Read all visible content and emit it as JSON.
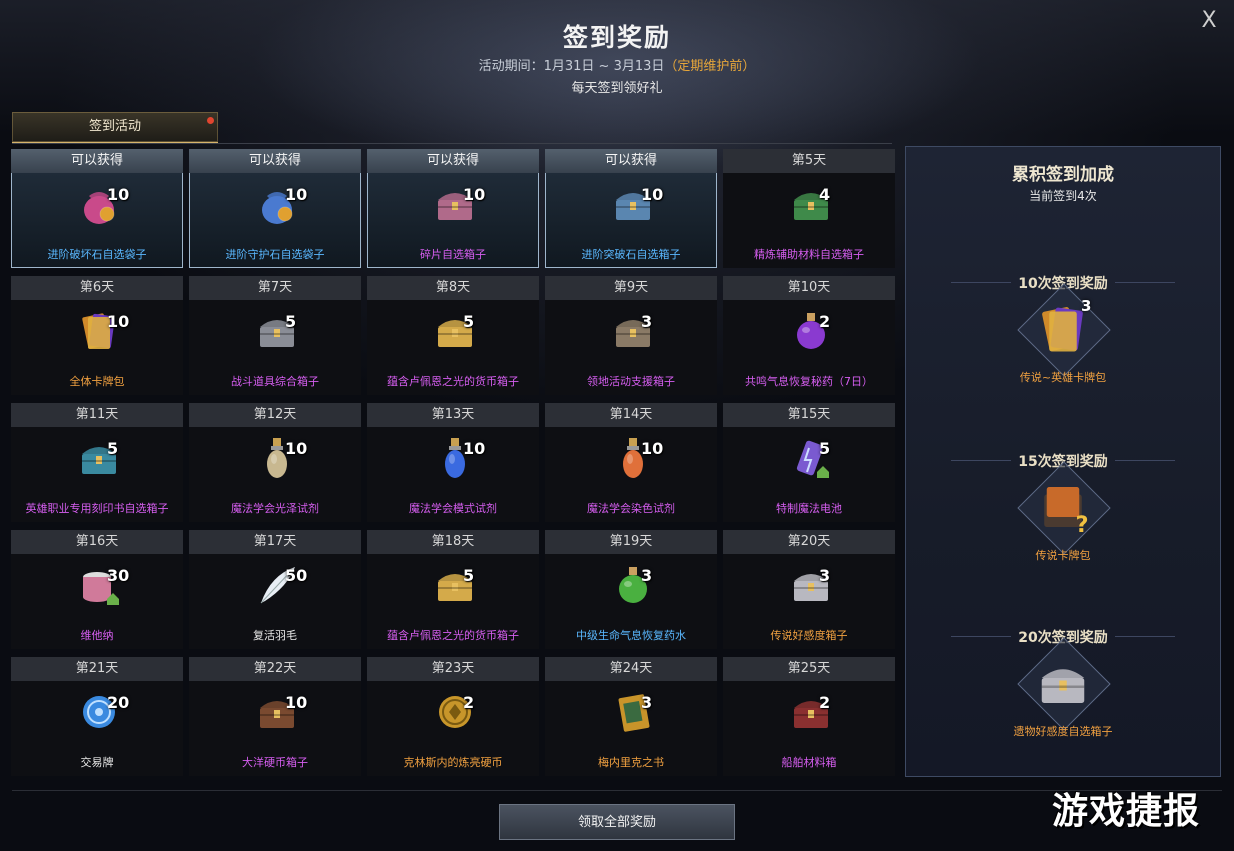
{
  "header": {
    "title": "签到奖励",
    "period_prefix": "活动期间：",
    "period_range": "1月31日 ~ 3月13日",
    "period_note": "（定期维护前）",
    "daily_text": "每天签到领好礼",
    "close_label": "X"
  },
  "tabs": [
    {
      "label": "签到活动"
    }
  ],
  "cells": [
    {
      "header": "可以获得",
      "qty": "10",
      "name": "进阶破坏石自选袋子",
      "icon": "pouch-icon",
      "state": "available",
      "rarity": "blue",
      "color": "#c94a8a"
    },
    {
      "header": "可以获得",
      "qty": "10",
      "name": "进阶守护石自选袋子",
      "icon": "pouch-icon",
      "state": "available",
      "rarity": "blue",
      "color": "#4a7ad0"
    },
    {
      "header": "可以获得",
      "qty": "10",
      "name": "碎片自选箱子",
      "icon": "chest-icon",
      "state": "available",
      "rarity": "purple",
      "color": "#b06a8a"
    },
    {
      "header": "可以获得",
      "qty": "10",
      "name": "进阶突破石自选箱子",
      "icon": "chest-icon",
      "state": "available",
      "rarity": "blue",
      "color": "#5a86b0"
    },
    {
      "header": "第5天",
      "qty": "4",
      "name": "精炼辅助材料自选箱子",
      "icon": "chest-icon",
      "state": "locked",
      "rarity": "purple",
      "color": "#3f8a4a"
    },
    {
      "header": "第6天",
      "qty": "10",
      "name": "全体卡牌包",
      "icon": "card-pack-icon",
      "state": "locked",
      "rarity": "orange",
      "color": "#d08a2a"
    },
    {
      "header": "第7天",
      "qty": "5",
      "name": "战斗道具综合箱子",
      "icon": "chest-icon",
      "state": "locked",
      "rarity": "purple",
      "color": "#8a8d96"
    },
    {
      "header": "第8天",
      "qty": "5",
      "name": "蕴含卢佩恩之光的货币箱子",
      "icon": "chest-icon",
      "state": "locked",
      "rarity": "purple",
      "color": "#d4aa4a"
    },
    {
      "header": "第9天",
      "qty": "3",
      "name": "领地活动支援箱子",
      "icon": "chest-icon",
      "state": "locked",
      "rarity": "purple",
      "color": "#8a7a66"
    },
    {
      "header": "第10天",
      "qty": "2",
      "name": "共鸣气息恢复秘药（7日）",
      "icon": "potion-icon",
      "state": "locked",
      "rarity": "purple",
      "color": "#8a3ad0"
    },
    {
      "header": "第11天",
      "qty": "5",
      "name": "英雄职业专用刻印书自选箱子",
      "icon": "chest-icon",
      "state": "locked",
      "rarity": "purple",
      "color": "#3a8aa0"
    },
    {
      "header": "第12天",
      "qty": "10",
      "name": "魔法学会光泽试剂",
      "icon": "vial-icon",
      "state": "locked",
      "rarity": "purple",
      "color": "#c8b890"
    },
    {
      "header": "第13天",
      "qty": "10",
      "name": "魔法学会模式试剂",
      "icon": "vial-icon",
      "state": "locked",
      "rarity": "purple",
      "color": "#3a6ae0"
    },
    {
      "header": "第14天",
      "qty": "10",
      "name": "魔法学会染色试剂",
      "icon": "vial-icon",
      "state": "locked",
      "rarity": "purple",
      "color": "#e0703a"
    },
    {
      "header": "第15天",
      "qty": "5",
      "name": "特制魔法电池",
      "icon": "battery-icon",
      "state": "locked",
      "rarity": "purple",
      "color": "#7a5ad0"
    },
    {
      "header": "第16天",
      "qty": "30",
      "name": "维他纳",
      "icon": "can-icon",
      "state": "locked",
      "rarity": "purple",
      "color": "#d07a9a"
    },
    {
      "header": "第17天",
      "qty": "50",
      "name": "复活羽毛",
      "icon": "feather-icon",
      "state": "locked",
      "rarity": "white",
      "color": "#e8eef5"
    },
    {
      "header": "第18天",
      "qty": "5",
      "name": "蕴含卢佩恩之光的货币箱子",
      "icon": "chest-icon",
      "state": "locked",
      "rarity": "purple",
      "color": "#d4aa4a"
    },
    {
      "header": "第19天",
      "qty": "3",
      "name": "中级生命气息恢复药水",
      "icon": "potion-icon",
      "state": "locked",
      "rarity": "blue",
      "color": "#4ab040"
    },
    {
      "header": "第20天",
      "qty": "3",
      "name": "传说好感度箱子",
      "icon": "chest-icon",
      "state": "locked",
      "rarity": "orange",
      "color": "#b8b8c0"
    },
    {
      "header": "第21天",
      "qty": "20",
      "name": "交易牌",
      "icon": "token-icon",
      "state": "locked",
      "rarity": "white",
      "color": "#3a8ae0"
    },
    {
      "header": "第22天",
      "qty": "10",
      "name": "大洋硬币箱子",
      "icon": "chest-icon",
      "state": "locked",
      "rarity": "purple",
      "color": "#7a4a30"
    },
    {
      "header": "第23天",
      "qty": "2",
      "name": "克林斯内的炼亮硬币",
      "icon": "coin-icon",
      "state": "locked",
      "rarity": "orange",
      "color": "#c8962a"
    },
    {
      "header": "第24天",
      "qty": "3",
      "name": "梅内里克之书",
      "icon": "book-icon",
      "state": "locked",
      "rarity": "orange",
      "color": "#c8942a"
    },
    {
      "header": "第25天",
      "qty": "2",
      "name": "船舶材料箱",
      "icon": "chest-icon",
      "state": "locked",
      "rarity": "purple",
      "color": "#8a3030"
    }
  ],
  "side": {
    "title": "累积签到加成",
    "subtitle": "当前签到4次",
    "milestones": [
      {
        "label": "10次签到奖励",
        "qty": "3",
        "name": "传说~英雄卡牌包",
        "icon": "card-pack-icon",
        "color": "#d08a2a"
      },
      {
        "label": "15次签到奖励",
        "qty": "",
        "name": "传说卡牌包",
        "icon": "card-pack-mystery-icon",
        "color": "#c86a2a"
      },
      {
        "label": "20次签到奖励",
        "qty": "",
        "name": "遗物好感度自选箱子",
        "icon": "chest-icon",
        "color": "#b8b8c0"
      }
    ]
  },
  "footer": {
    "claim_all_label": "领取全部奖励"
  },
  "watermark": "游戏捷报",
  "colors": {
    "blue": "#5ab8ff",
    "purple": "#d65ef0",
    "orange": "#f0a040",
    "white": "#eaeaea",
    "accent_gold": "#d7b56c"
  }
}
